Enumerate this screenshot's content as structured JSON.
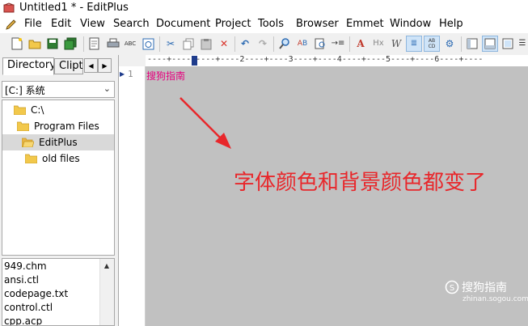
{
  "window": {
    "title": "Untitled1 * - EditPlus"
  },
  "menu": [
    "File",
    "Edit",
    "View",
    "Search",
    "Document",
    "Project",
    "Tools",
    "Browser",
    "Emmet",
    "Window",
    "Help"
  ],
  "toolbar": {
    "icons": [
      "new-file-icon",
      "open-folder-icon",
      "save-icon",
      "save-all-icon",
      "print-preview-icon",
      "print-icon",
      "spell-check-icon",
      "browser-view-icon",
      "cut-icon",
      "copy-icon",
      "paste-icon",
      "delete-icon",
      "undo-icon",
      "redo-icon",
      "find-icon",
      "replace-icon",
      "find-in-files-icon",
      "goto-line-icon",
      "font-icon",
      "html-toolbar-icon",
      "word-wrap-icon",
      "line-number-icon",
      "column-select-icon",
      "preferences-icon",
      "directory-window-icon",
      "output-window-icon",
      "fullscreen-icon",
      "list-icon"
    ]
  },
  "sidebar": {
    "tabs": [
      "Directory",
      "Clipt"
    ],
    "drive": "[C:] 系统",
    "tree": [
      {
        "label": "C:\\",
        "selected": false
      },
      {
        "label": "Program Files",
        "selected": false
      },
      {
        "label": "EditPlus",
        "selected": true
      },
      {
        "label": "old files",
        "selected": false
      }
    ],
    "files": [
      "949.chm",
      "ansi.ctl",
      "codepage.txt",
      "control.ctl",
      "cpp.acp"
    ]
  },
  "ruler": {
    "text": "----+----1----+----2----+----3----+----4----+----5----+----6----+----"
  },
  "editor": {
    "line_number": "1",
    "line_text": "搜狗指南",
    "annotation": "字体颜色和背景颜色都变了",
    "watermark_main": "搜狗指南",
    "watermark_sub": "zhinan.sogou.com"
  },
  "colors": {
    "editor_background": "#c1c1c1",
    "text_color": "#e6007e",
    "annotation_color": "#e8272b"
  }
}
